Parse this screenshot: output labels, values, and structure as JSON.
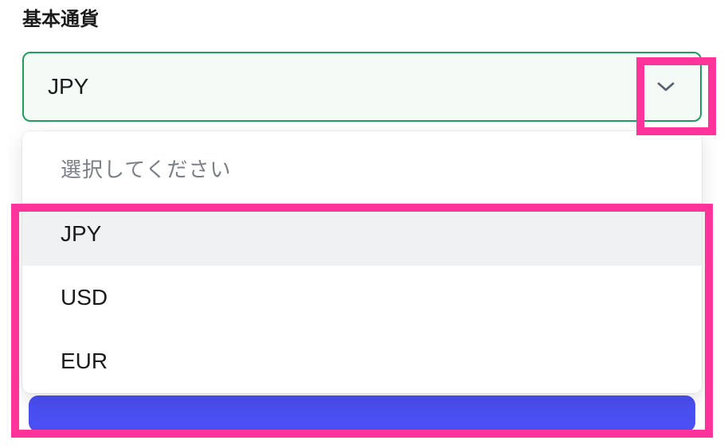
{
  "form": {
    "label": "基本通貨",
    "selected_value": "JPY",
    "dropdown": {
      "placeholder": "選択してください",
      "options": [
        {
          "value": "JPY",
          "highlighted": true
        },
        {
          "value": "USD",
          "highlighted": false
        },
        {
          "value": "EUR",
          "highlighted": false
        }
      ]
    }
  },
  "colors": {
    "select_border": "#1f9d5c",
    "select_bg": "#f4fbf6",
    "highlight_border": "#ff3399",
    "blue_accent": "#4a4ff2"
  }
}
